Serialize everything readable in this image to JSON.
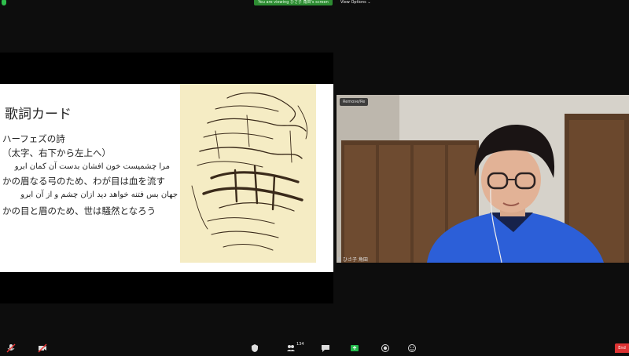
{
  "top_bar": {
    "viewing_banner": "You are viewing ひさ子 角田's screen",
    "view_options": "View Options ⌄"
  },
  "slide": {
    "title": "歌詞カード",
    "line1": "ハーフェズの詩",
    "line2": "（太字、右下から左上へ）",
    "persian1": "مرا چشمیست خون افشان بدست آن کمان ابرو",
    "line3": "かの眉なる弓のため、わが目は血を流す",
    "persian2": "جهان بس فتنه خواهد دید ازان چشم و از آن ابرو",
    "line4": "かの目と眉のため、世は騒然となろう"
  },
  "video": {
    "name_tag": "Remove/Re",
    "participant_name": "ひさ子 角田"
  },
  "toolbar": {
    "participants_count": "134",
    "end_label": "End"
  }
}
